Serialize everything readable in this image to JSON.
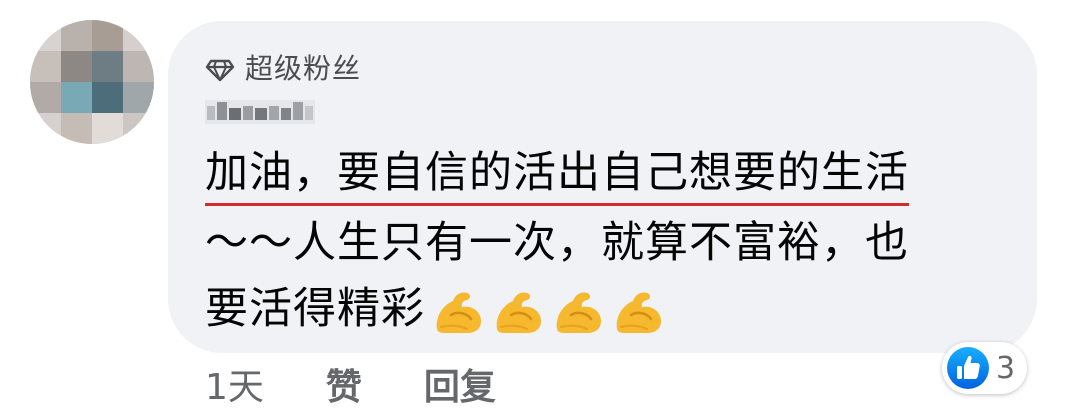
{
  "comment": {
    "badge_label": "超级粉丝",
    "badge_icon": "diamond-icon",
    "author_name_blurred": true,
    "text_line_1": "加油，要自信的活出自己想要的生活",
    "text_line_2": "～～人生只有一次，就算不富裕，也",
    "text_line_3": "要活得精彩",
    "emoji": [
      "flexed-biceps",
      "flexed-biceps",
      "flexed-biceps",
      "flexed-biceps"
    ],
    "underline_color": "#d42a2e"
  },
  "actions": {
    "time": "1天",
    "like_label": "赞",
    "reply_label": "回复"
  },
  "reactions": {
    "icon": "like-thumb-icon",
    "count": "3",
    "color": "#1877f2"
  },
  "colors": {
    "bubble": "#f0f2f5",
    "text": "#050505",
    "secondary": "#65676b"
  }
}
